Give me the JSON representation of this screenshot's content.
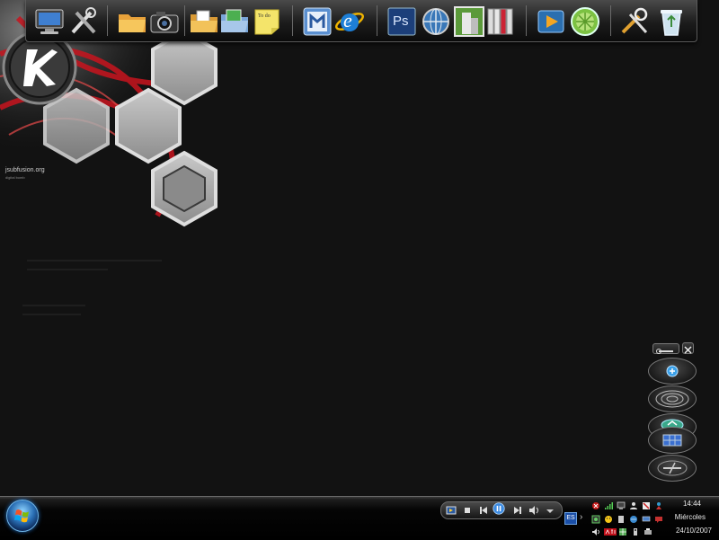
{
  "wallpaper": {
    "site_text": "jsubfusion.org",
    "sub_text": "digital bomb"
  },
  "dock": {
    "icons": [
      {
        "name": "my-computer-icon",
        "tooltip": ""
      },
      {
        "name": "tools-icon",
        "tooltip": ""
      },
      {
        "name": "folder-icon",
        "tooltip": ""
      },
      {
        "name": "camera-icon",
        "tooltip": ""
      },
      {
        "name": "documents-folder-icon",
        "tooltip": ""
      },
      {
        "name": "pictures-folder-icon",
        "tooltip": ""
      },
      {
        "name": "sticky-note-icon",
        "label": "To do"
      },
      {
        "name": "maxthon-icon",
        "tooltip": ""
      },
      {
        "name": "internet-explorer-icon",
        "label": "e"
      },
      {
        "name": "photoshop-icon",
        "label": "Ps"
      },
      {
        "name": "network-globe-icon",
        "tooltip": ""
      },
      {
        "name": "building-icon",
        "tooltip": ""
      },
      {
        "name": "books-icon",
        "tooltip": ""
      },
      {
        "name": "media-player-icon",
        "tooltip": ""
      },
      {
        "name": "limewire-icon",
        "tooltip": ""
      },
      {
        "name": "control-tools-icon",
        "tooltip": ""
      },
      {
        "name": "recycle-bin-icon",
        "tooltip": ""
      }
    ]
  },
  "taskbar": {
    "clock_time": "14:44",
    "clock_day": "Miércoles",
    "clock_date": "24/10/2007",
    "language": "ES"
  },
  "colors": {
    "accent_red": "#c8141e",
    "hex_gray": "#9a9a9a",
    "start_blue": "#2a6fb5"
  }
}
